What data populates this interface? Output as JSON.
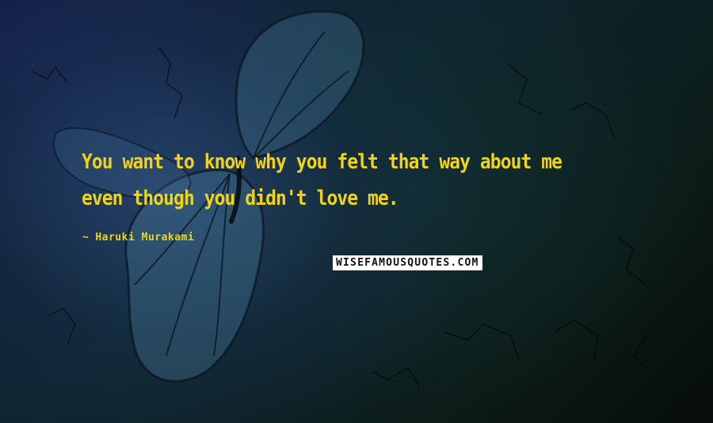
{
  "quote": {
    "text": "You want to know why you felt that way about me even though you didn't love me.",
    "color": "#f1d317"
  },
  "author": {
    "dash": "~",
    "name": "Haruki Murakami"
  },
  "watermark": {
    "text": "WISEFAMOUSQUOTES.COM"
  },
  "background": {
    "description_icon": "butterfly-icon"
  }
}
